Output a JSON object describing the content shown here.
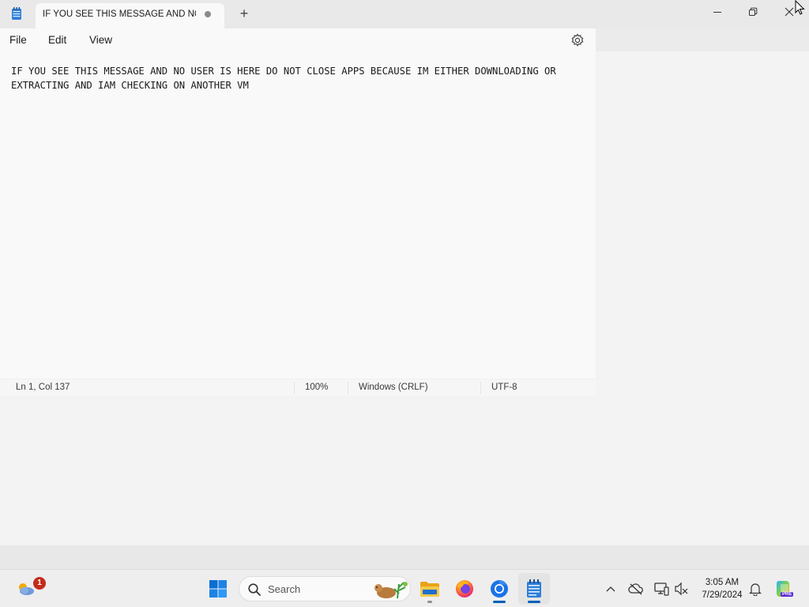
{
  "window": {
    "tab_title": "IF YOU SEE THIS MESSAGE AND NO USER IS HERE DO NOT CLOSE APPS BECAUSE IM EITHER DOWNLOADING OR EXTRACTING AND IAM CHECKING ON ANOTHER VM",
    "new_tab_label": "+",
    "unsaved_indicator": "dot"
  },
  "menu": {
    "file": "File",
    "edit": "Edit",
    "view": "View"
  },
  "editor": {
    "content": "IF YOU SEE THIS MESSAGE AND NO USER IS HERE DO NOT CLOSE APPS BECAUSE IM EITHER DOWNLOADING OR EXTRACTING AND IAM CHECKING ON ANOTHER VM"
  },
  "status": {
    "position": "Ln 1, Col 137",
    "zoom": "100%",
    "line_ending": "Windows (CRLF)",
    "encoding": "UTF-8"
  },
  "taskbar": {
    "widgets_badge": "1",
    "search_label": "Search",
    "apps": [
      "file-explorer",
      "firefox",
      "chrome",
      "notepad"
    ]
  },
  "tray": {
    "time": "3:05 AM",
    "date": "7/29/2024",
    "copilot_tag": "PRE"
  },
  "colors": {
    "accent": "#005fb8",
    "badge": "#c42b1c"
  }
}
